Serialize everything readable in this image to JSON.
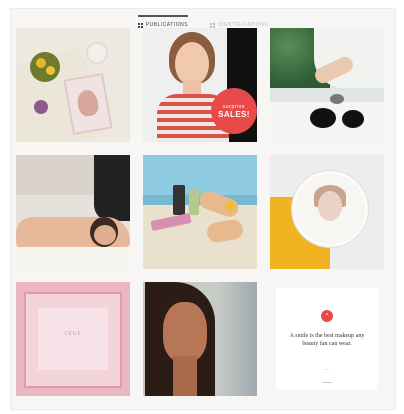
{
  "tabs": [
    {
      "label": "PUBLICATIONS",
      "active": true
    },
    {
      "label": "IDENTIFICATIONS",
      "active": false
    }
  ],
  "posts": [
    {
      "name": "flat-lay-skincare"
    },
    {
      "name": "model-sale",
      "badge_line1": "surprise",
      "badge_line2": "SALES!"
    },
    {
      "name": "skincare-jars"
    },
    {
      "name": "back-massage"
    },
    {
      "name": "product-testing"
    },
    {
      "name": "compact-mirror"
    },
    {
      "name": "pink-gift-box",
      "brand": "CEGE"
    },
    {
      "name": "portrait-woman"
    },
    {
      "name": "quote-card",
      "quote": "A smile is the best makeup any beauty fan can wear.",
      "author": "— ",
      "icon": "quote-icon"
    }
  ],
  "colors": {
    "accent": "#e94b43",
    "background": "#f7f6f5"
  }
}
